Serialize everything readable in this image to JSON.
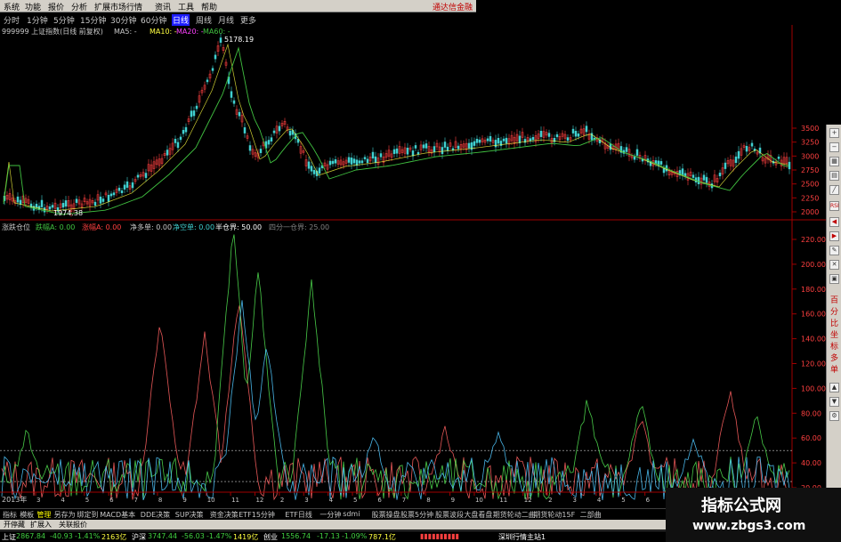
{
  "menu": [
    "系统",
    "功能",
    "报价",
    "分析",
    "扩展市场行情",
    "资讯",
    "工具",
    "帮助"
  ],
  "brand": "通达信金融",
  "periods": [
    "分时",
    "1分钟",
    "5分钟",
    "15分钟",
    "30分钟",
    "60分钟",
    "日线",
    "周线",
    "月线",
    "更多"
  ],
  "active_period": "日线",
  "main_panel": {
    "title": "999999 上证指数(日线 前复权)",
    "ma5": "MA5: -",
    "ma10": "MA10: -",
    "ma20": "MA20: -",
    "ma60": "MA60: -",
    "high_label": "5178.19",
    "low_label": "1974.38",
    "y_ticks": [
      "3500",
      "3250",
      "3000",
      "2750",
      "2500",
      "2250",
      "2000"
    ],
    "colors": {
      "up": "#ff4040",
      "down": "#40d0d0",
      "ma": "#40c040",
      "ma20": "#ff40ff"
    }
  },
  "indicator_panel": {
    "title": "涨跌仓位",
    "label_a": "跌幅A: 0.00",
    "label_b": "涨幅A: 0.00",
    "label_c": "净多单: 0.00",
    "label_d": "净空单: 0.00",
    "label_e": "半仓界: 50.00",
    "label_f": "四分一仓界: 25.00",
    "y_ticks": [
      "220.00",
      "200.00",
      "180.00",
      "160.00",
      "140.00",
      "120.00",
      "100.00",
      "80.00",
      "60.00",
      "40.00",
      "20.00"
    ],
    "year_label": "2013年",
    "month_ticks": [
      "3",
      "4",
      "5",
      "6",
      "7",
      "8",
      "9",
      "10",
      "11",
      "12",
      "2",
      "3",
      "4",
      "5",
      "6",
      "7",
      "8",
      "9",
      "10",
      "11",
      "12",
      "2",
      "3",
      "4",
      "5",
      "6",
      "7",
      "8",
      "9",
      "10",
      "11"
    ]
  },
  "right_panel": {
    "text1": "RSI",
    "vertical_text": [
      "百",
      "分",
      "比",
      "坐",
      "标",
      "多",
      "单"
    ]
  },
  "func_tabs": [
    "指标",
    "模板",
    "管理",
    "另存为",
    "绑定到",
    "MACD基本",
    "DDE决策",
    "SUP决策",
    "资金决策",
    "ETF15分钟",
    "ETF日线",
    "一分钟",
    "sdmi",
    "股票操盘",
    "股票5分钟",
    "股票波段",
    "大盘看盘",
    "期货轮动二曲",
    "期货轮动15F",
    "二部曲"
  ],
  "selected_func": "管理",
  "nav_tabs": [
    "开停藏",
    "扩展入",
    "关联报价"
  ],
  "status": {
    "sh_label": "上证",
    "sh_value": "2867.84",
    "sh_change": "-40.93",
    "sh_pct": "-1.41%",
    "sh_amount": "2163亿",
    "hs_label": "沪深",
    "hs_value": "3747.44",
    "hs_change": "-56.03",
    "hs_pct": "-1.47%",
    "hs_amount": "1419亿",
    "cy_label": "创业",
    "cy_value": "1556.74",
    "cy_change": "-17.13",
    "cy_pct": "-1.09%",
    "cy_amount": "787.1亿",
    "server": "深圳行情主站1"
  },
  "watermark": {
    "line1": "指标公式网",
    "line2": "www.zbgs3.com"
  }
}
